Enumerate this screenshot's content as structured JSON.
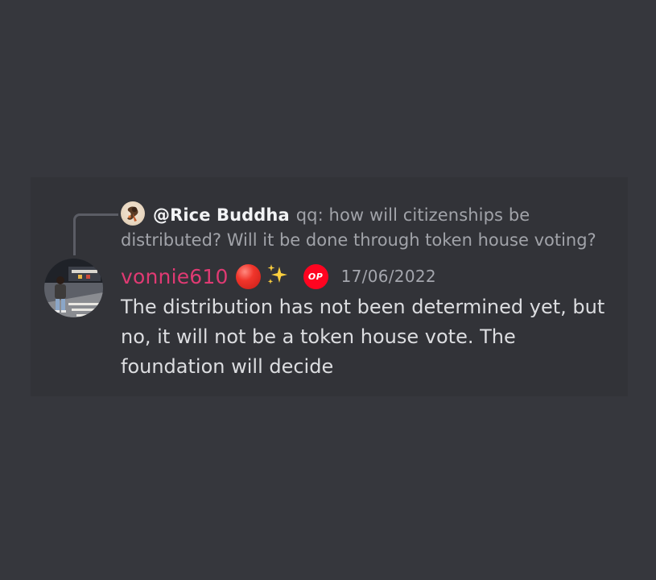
{
  "reply": {
    "author": "@Rice Buddha",
    "preview_line1": "qq: how will citizenships be",
    "preview_line2": "distributed? Will it be done through token house voting?"
  },
  "message": {
    "username": "vonnie610",
    "badges": [
      "red-circle-emoji",
      "sparkles-emoji",
      "optimism-op-icon"
    ],
    "op_badge_text": "OP",
    "timestamp": "17/06/2022",
    "body": "The distribution has not been determined yet, but\nno, it will not be a token house vote. The\nfoundation will decide"
  },
  "colors": {
    "background": "#36373d",
    "card": "#323338",
    "username": "#e03a73",
    "text": "#dcdde0",
    "muted": "#a1a3a9",
    "op_red": "#ff0420"
  }
}
